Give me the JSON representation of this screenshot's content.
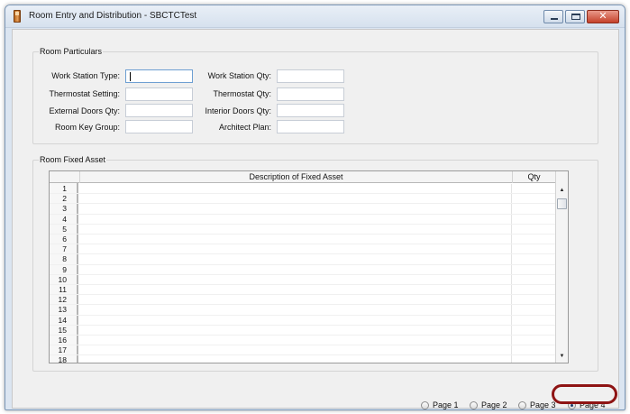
{
  "window": {
    "title": "Room Entry and Distribution - SBCTCTest",
    "close_glyph": "✕",
    "min_glyph": "",
    "max_glyph": ""
  },
  "room_particulars": {
    "group_title": "Room Particulars",
    "fields": [
      {
        "label": "Work Station Type:",
        "value": ""
      },
      {
        "label": "Thermostat Setting:",
        "value": ""
      },
      {
        "label": "External Doors Qty:",
        "value": ""
      },
      {
        "label": "Room Key Group:",
        "value": ""
      },
      {
        "label": "Work Station Qty:",
        "value": ""
      },
      {
        "label": "Thermostat Qty:",
        "value": ""
      },
      {
        "label": "Interior Doors Qty:",
        "value": ""
      },
      {
        "label": "Architect Plan:",
        "value": ""
      }
    ]
  },
  "room_fixed_asset": {
    "group_title": "Room Fixed Asset",
    "columns": [
      "Description of Fixed Asset",
      "Qty"
    ],
    "rows": [
      "1",
      "2",
      "3",
      "4",
      "5",
      "6",
      "7",
      "8",
      "9",
      "10",
      "11",
      "12",
      "13",
      "14",
      "15",
      "16",
      "17",
      "18"
    ],
    "scroll_up": "▲",
    "scroll_down": "▼"
  },
  "pager": {
    "pages": [
      {
        "label": "Page 1",
        "selected": false
      },
      {
        "label": "Page 2",
        "selected": false
      },
      {
        "label": "Page 3",
        "selected": false
      },
      {
        "label": "Page 4",
        "selected": true
      }
    ]
  },
  "colors": {
    "highlight_ring": "#8e1414",
    "window_border": "#7a96b6",
    "close_button": "#c5412a"
  }
}
